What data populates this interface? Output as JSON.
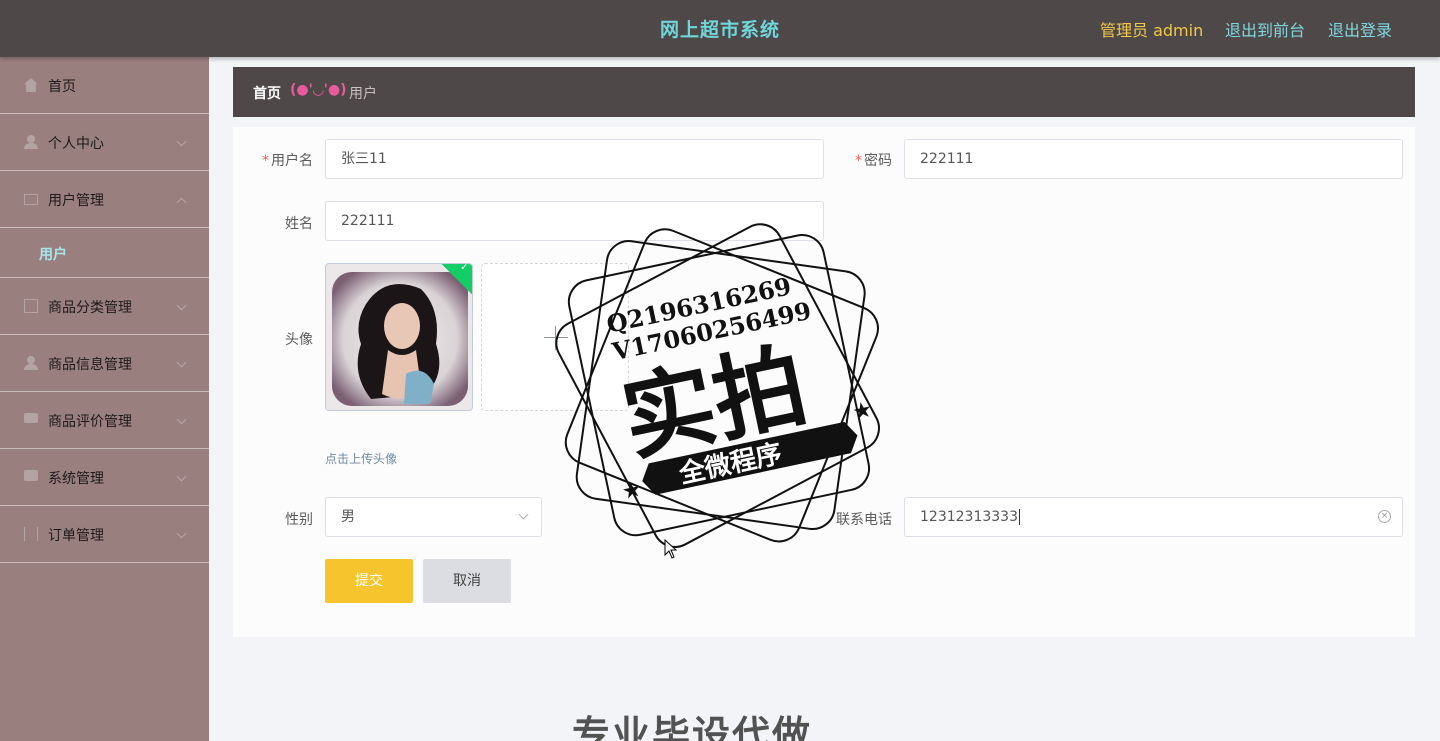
{
  "header": {
    "title": "网上超市系统",
    "admin": "管理员 admin",
    "to_front": "退出到前台",
    "logout": "退出登录"
  },
  "sidebar": {
    "items": [
      {
        "label": "首页",
        "icon": "home-icon"
      },
      {
        "label": "个人中心",
        "icon": "user-icon"
      },
      {
        "label": "用户管理",
        "icon": "mail-icon"
      },
      {
        "label": "用户",
        "icon": ""
      },
      {
        "label": "商品分类管理",
        "icon": "box-icon"
      },
      {
        "label": "商品信息管理",
        "icon": "user-icon"
      },
      {
        "label": "商品评价管理",
        "icon": "monitor-icon"
      },
      {
        "label": "系统管理",
        "icon": "chat-icon"
      },
      {
        "label": "订单管理",
        "icon": "bracket-icon"
      }
    ]
  },
  "breadcrumb": {
    "home": "首页",
    "separator": "(●'◡'●)",
    "current": "用户"
  },
  "form": {
    "username_label": "用户名",
    "username_value": "张三11",
    "password_label": "密码",
    "password_value": "222111",
    "name_label": "姓名",
    "name_value": "222111",
    "avatar_label": "头像",
    "upload_tip": "点击上传头像",
    "gender_label": "性别",
    "gender_value": "男",
    "phone_label": "联系电话",
    "phone_value": "12312313333",
    "submit": "提交",
    "cancel": "取消"
  },
  "watermark": {
    "line1": "Q2196316269",
    "line2": "V17060256499",
    "big": "实拍",
    "banner": "全微程序",
    "bottom": "专业毕设代做"
  }
}
